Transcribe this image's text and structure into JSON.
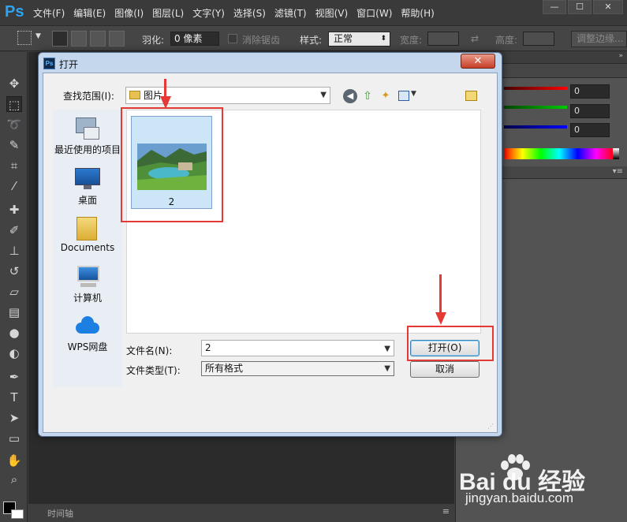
{
  "app": {
    "logo": "Ps"
  },
  "menu": [
    "文件(F)",
    "编辑(E)",
    "图像(I)",
    "图层(L)",
    "文字(Y)",
    "选择(S)",
    "滤镜(T)",
    "视图(V)",
    "窗口(W)",
    "帮助(H)"
  ],
  "window_controls": {
    "minimize": "—",
    "maximize": "☐",
    "close": "✕"
  },
  "options_bar": {
    "feather_label": "羽化:",
    "feather_value": "0 像素",
    "antialias_label": "消除锯齿",
    "style_label": "样式:",
    "style_value": "正常",
    "width_label": "宽度:",
    "height_label": "高度:",
    "refine_edge_label": "调整边缘..."
  },
  "timeline": {
    "label": "时间轴"
  },
  "color_panel": {
    "r": "0",
    "g": "0",
    "b": "0"
  },
  "dialog": {
    "title": "打开",
    "look_in_label": "查找范围(I):",
    "look_in_value": "图片",
    "places": [
      {
        "label": "最近使用的项目",
        "icon": "recent-items-icon"
      },
      {
        "label": "桌面",
        "icon": "desktop-icon"
      },
      {
        "label": "Documents",
        "icon": "documents-folder-icon"
      },
      {
        "label": "计算机",
        "icon": "computer-icon"
      },
      {
        "label": "WPS网盘",
        "icon": "wps-cloud-icon"
      }
    ],
    "files": [
      {
        "name": "2"
      }
    ],
    "file_name_label": "文件名(N):",
    "file_name_value": "2",
    "file_type_label": "文件类型(T):",
    "file_type_value": "所有格式",
    "open_button": "打开(O)",
    "cancel_button": "取消"
  },
  "watermark": {
    "brand": "Bai du 经验",
    "url": "jingyan.baidu.com"
  },
  "colors": {
    "highlight": "#e53935",
    "ps_blue": "#2ea3f2"
  }
}
